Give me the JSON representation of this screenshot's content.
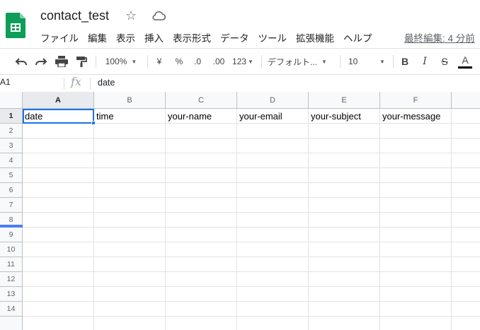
{
  "app": {
    "title": "contact_test",
    "last_edit": "最終編集: 4 分前"
  },
  "menu": [
    "ファイル",
    "編集",
    "表示",
    "挿入",
    "表示形式",
    "データ",
    "ツール",
    "拡張機能",
    "ヘルプ"
  ],
  "toolbar": {
    "zoom": "100%",
    "currency": "¥",
    "percent": "%",
    "decrease_decimal": ".0",
    "increase_decimal": ".00",
    "number_format": "123",
    "font": "デフォルト...",
    "font_size": "10",
    "bold": "B",
    "italic": "I",
    "strike": "S",
    "text_color": "A"
  },
  "formula_bar": {
    "name_box": "A1",
    "fx": "fx",
    "value": "date"
  },
  "sheet": {
    "columns": [
      "A",
      "B",
      "C",
      "D",
      "E",
      "F"
    ],
    "rows": [
      "1",
      "2",
      "3",
      "4",
      "5",
      "6",
      "7",
      "8",
      "9",
      "10",
      "11",
      "12",
      "13",
      "14"
    ],
    "row1": [
      "date",
      "time",
      "your-name",
      "your-email",
      "your-subject",
      "your-message"
    ],
    "selected_cell": "A1"
  },
  "colors": {
    "accent": "#1a73e8",
    "sheets_green": "#0f9d58"
  }
}
